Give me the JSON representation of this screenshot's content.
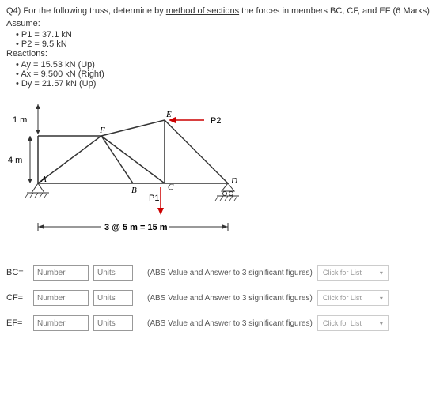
{
  "question": {
    "prefix": "Q4) For the following truss, determine by ",
    "method": "method of sections",
    "suffix": " the forces in members BC, CF, and EF (6 Marks)"
  },
  "assume_label": "Assume:",
  "assumptions": {
    "p1": "P1 = 37.1 kN",
    "p2": "P2 = 9.5 kN"
  },
  "reactions_label": "Reactions:",
  "reactions": {
    "ay": "Ay = 15.53 kN (Up)",
    "ax": "Ax = 9.500 kN (Right)",
    "dy": "Dy = 21.57 kN (Up)"
  },
  "diagram": {
    "height_top": "1 m",
    "height_bottom": "4 m",
    "span": "3 @ 5 m = 15 m",
    "p1_label": "P1",
    "p2_label": "P2",
    "nodes": {
      "A": "A",
      "B": "B",
      "C": "C",
      "D": "D",
      "E": "E",
      "F": "F"
    }
  },
  "answers": {
    "bc": {
      "label": "BC=",
      "placeholder": "Number",
      "units": "Units"
    },
    "cf": {
      "label": "CF=",
      "placeholder": "Number",
      "units": "Units"
    },
    "ef": {
      "label": "EF=",
      "placeholder": "Number",
      "units": "Units"
    }
  },
  "hint": "(ABS Value and Answer to 3 significant figures)",
  "dropdown": "Click for List"
}
